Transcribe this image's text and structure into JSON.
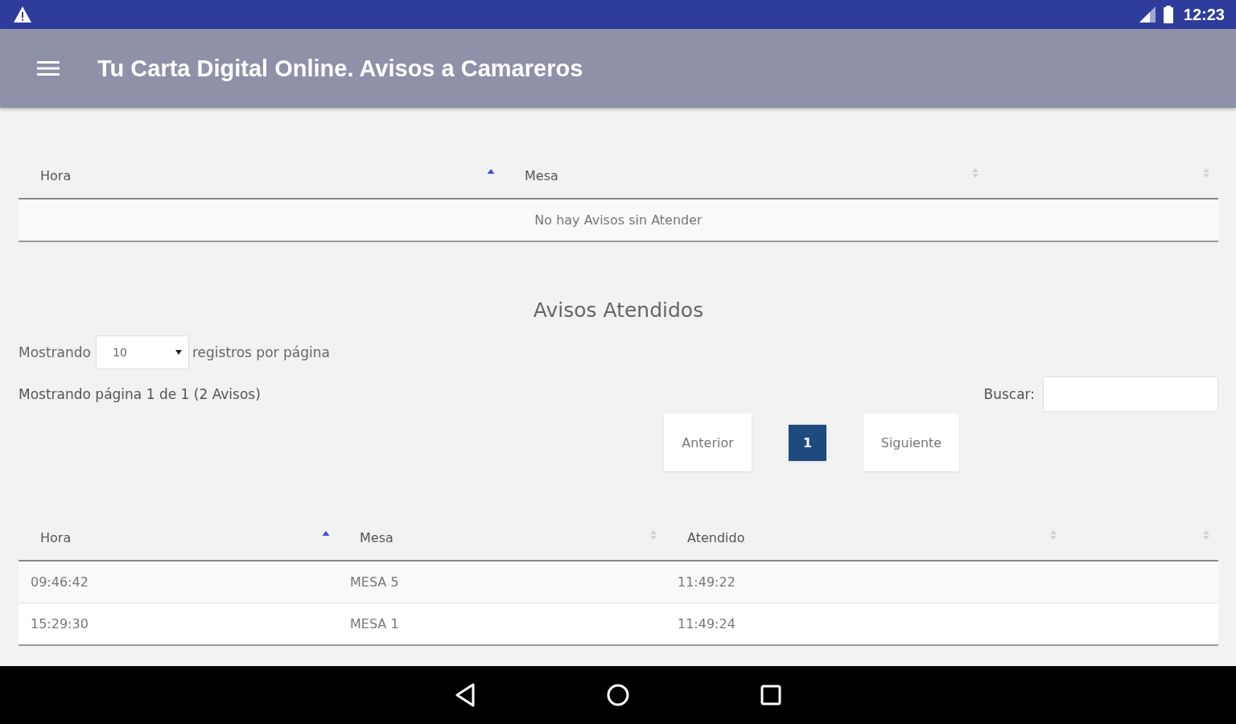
{
  "status_bar": {
    "time": "12:23"
  },
  "app_bar": {
    "title": "Tu Carta Digital Online. Avisos a Camareros"
  },
  "pending_table": {
    "columns": [
      {
        "label": "Hora",
        "sorted": true
      },
      {
        "label": "Mesa",
        "sorted": false
      },
      {
        "sorted": false
      }
    ],
    "empty_message": "No hay Avisos sin Atender"
  },
  "attended": {
    "heading": "Avisos Atendidos",
    "length_prefix": "Mostrando",
    "length_value": "10",
    "length_suffix": "registros por página",
    "info": "Mostrando página 1 de 1 (2 Avisos)",
    "search_label": "Buscar:",
    "pagination": [
      {
        "label": "Anterior",
        "kind": "nav",
        "selected": false
      },
      {
        "label": "1",
        "kind": "page",
        "selected": true
      },
      {
        "label": "Siguiente",
        "kind": "nav",
        "selected": false
      }
    ],
    "table": {
      "columns": [
        {
          "label": "Hora",
          "sorted": true
        },
        {
          "label": "Mesa",
          "sorted": false
        },
        {
          "label": "Atendido",
          "sorted": false
        },
        {
          "sorted": false
        }
      ],
      "rows": [
        [
          "09:46:42",
          "MESA 5",
          "11:49:22",
          ""
        ],
        [
          "15:29:30",
          "MESA 1",
          "11:49:24",
          ""
        ]
      ]
    }
  }
}
